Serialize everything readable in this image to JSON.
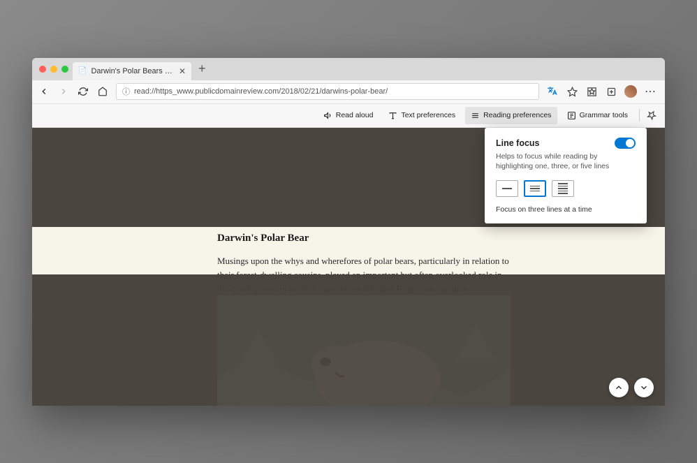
{
  "tab": {
    "title": "Darwin's Polar Bears - The..."
  },
  "url": "read://https_www.publicdomainreview.com/2018/02/21/darwins-polar-bear/",
  "readerToolbar": {
    "readAloud": "Read aloud",
    "textPreferences": "Text preferences",
    "readingPreferences": "Reading preferences",
    "grammarTools": "Grammar tools"
  },
  "popup": {
    "title": "Line focus",
    "description": "Helps to focus while reading by highlighting one, three, or five lines",
    "caption": "Focus on three lines at a time",
    "toggleOn": true,
    "selectedOption": 1
  },
  "article": {
    "title": "Darwin's Polar Bear",
    "paragraph": "Musings upon the whys and wherefores of polar bears, particularly in relation to their forest-dwelling cousins, played an important but often overlooked role in the development of evolutionary theory. Michael Engelhard explores."
  }
}
